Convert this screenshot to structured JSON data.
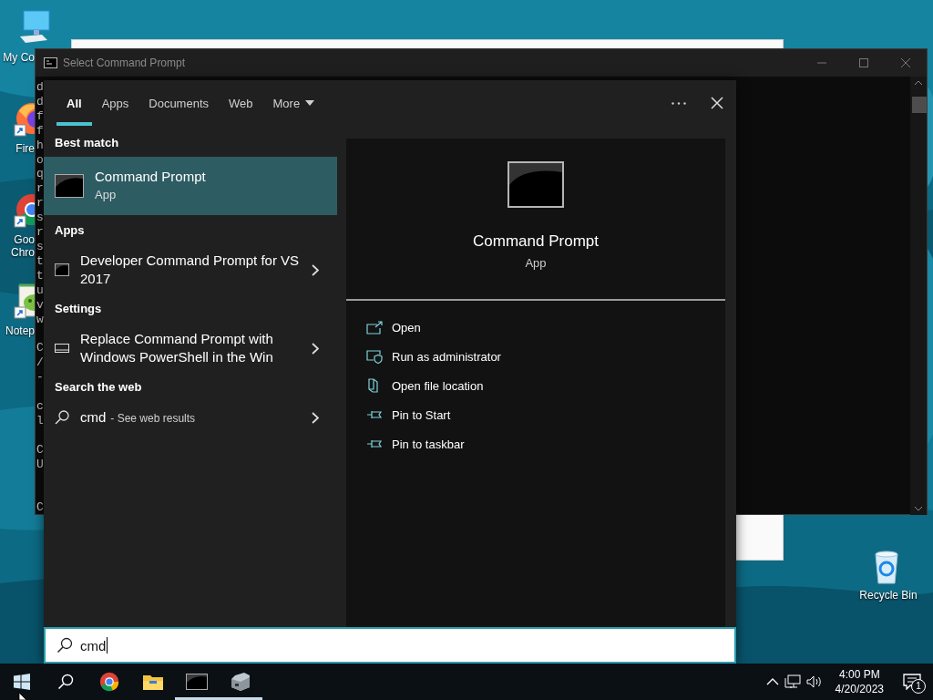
{
  "desktop": {
    "icons": [
      {
        "kind": "computer",
        "label_lines": [
          "My Co"
        ],
        "shortcut": false
      },
      {
        "kind": "firefox",
        "label_lines": [
          "Fire"
        ],
        "shortcut": true
      },
      {
        "kind": "chrome",
        "label_lines": [
          "Goo",
          "Chro"
        ],
        "shortcut": true
      },
      {
        "kind": "notepad",
        "label_lines": [
          "Notep"
        ],
        "shortcut": true
      },
      {
        "kind": "recycle",
        "label_lines": [
          "Recycle Bin"
        ],
        "shortcut": false
      }
    ]
  },
  "console_window": {
    "title": "Select Command Prompt",
    "text": "d\nd\nf\nf\nh\no\nq\nr\nr\ns\nr\ns\nt\nt\nu\nv\nw\n\nC\n/\n-\n\nc\nl\n\nC\nU\n\n\nC"
  },
  "search": {
    "tabs": [
      {
        "label": "All",
        "selected": true,
        "kind": "tab"
      },
      {
        "label": "Apps",
        "selected": false,
        "kind": "tab"
      },
      {
        "label": "Documents",
        "selected": false,
        "kind": "tab"
      },
      {
        "label": "Web",
        "selected": false,
        "kind": "tab"
      },
      {
        "label": "More",
        "selected": false,
        "kind": "dropdown"
      }
    ],
    "groups": [
      {
        "heading": "Best match",
        "items": [
          {
            "kind": "app",
            "title": "Command Prompt",
            "subtitle": "App",
            "selected": true,
            "chevron": false
          }
        ]
      },
      {
        "heading": "Apps",
        "items": [
          {
            "kind": "console",
            "title": "Developer Command Prompt for VS 2017",
            "selected": false,
            "chevron": true
          }
        ]
      },
      {
        "heading": "Settings",
        "items": [
          {
            "kind": "settings",
            "title": "Replace Command Prompt with Windows PowerShell in the Win",
            "selected": false,
            "chevron": true
          }
        ]
      },
      {
        "heading": "Search the web",
        "items": [
          {
            "kind": "web",
            "title": "cmd",
            "hint": "- See web results",
            "selected": false,
            "chevron": true
          }
        ]
      }
    ],
    "preview": {
      "title": "Command Prompt",
      "subtitle": "App",
      "actions": [
        {
          "kind": "open",
          "label": "Open"
        },
        {
          "kind": "admin",
          "label": "Run as administrator"
        },
        {
          "kind": "location",
          "label": "Open file location"
        },
        {
          "kind": "pin",
          "label": "Pin to Start"
        },
        {
          "kind": "pin",
          "label": "Pin to taskbar"
        }
      ]
    },
    "query": "cmd"
  },
  "taskbar": {
    "apps": [
      {
        "kind": "start",
        "running": false
      },
      {
        "kind": "search",
        "running": false
      },
      {
        "kind": "chrome",
        "running": false
      },
      {
        "kind": "explorer",
        "running": false
      },
      {
        "kind": "console",
        "running": true
      },
      {
        "kind": "device",
        "running": true
      }
    ],
    "time": "4:00 PM",
    "date": "4/20/2023",
    "notifications": "1"
  }
}
